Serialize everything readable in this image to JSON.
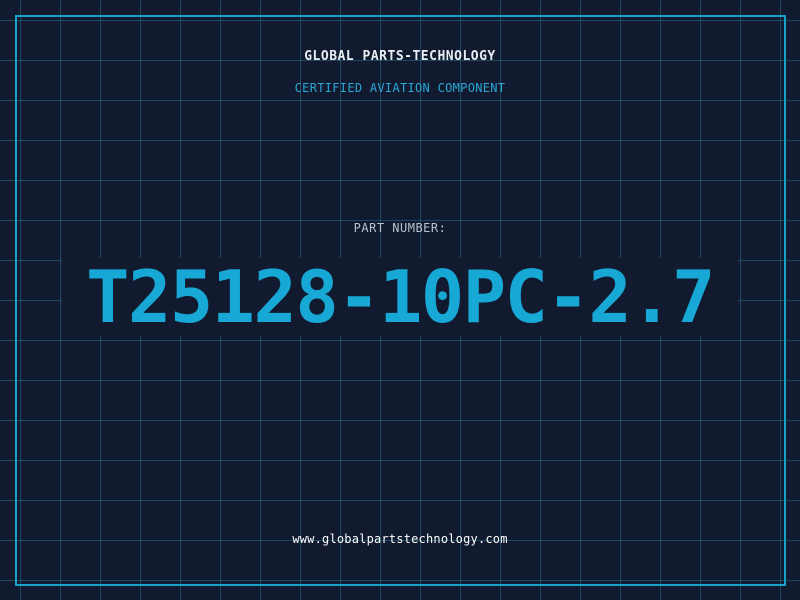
{
  "header": {
    "company": "GLOBAL PARTS-TECHNOLOGY",
    "subtitle": "CERTIFIED AVIATION COMPONENT"
  },
  "part": {
    "label": "PART NUMBER:",
    "number": "T25128-10PC-2.7"
  },
  "footer": {
    "website": "www.globalpartstechnology.com"
  },
  "colors": {
    "background": "#111a2f",
    "grid": "#226e8c",
    "frame": "#1aa3c9",
    "accent": "#18a8d6",
    "title_text": "#e8eef5"
  }
}
